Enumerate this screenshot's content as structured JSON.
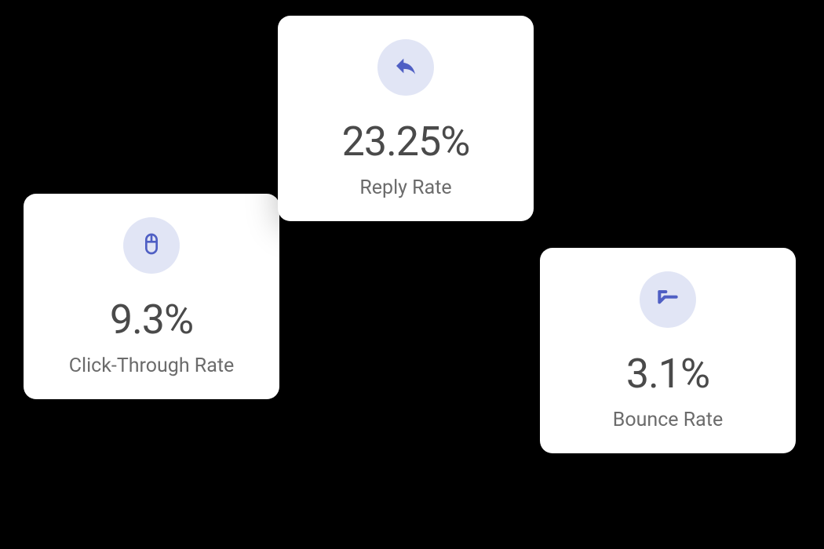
{
  "cards": {
    "reply": {
      "value": "23.25%",
      "label": "Reply Rate",
      "icon": "reply-icon"
    },
    "click": {
      "value": "9.3%",
      "label": "Click-Through Rate",
      "icon": "mouse-icon"
    },
    "bounce": {
      "value": "3.1%",
      "label": "Bounce Rate",
      "icon": "bounce-icon"
    }
  },
  "colors": {
    "icon_bg": "#e1e5f5",
    "icon_fill": "#4f5fc4",
    "card_bg": "#ffffff",
    "value_text": "#4a4a4a",
    "label_text": "#6b6b6b"
  }
}
